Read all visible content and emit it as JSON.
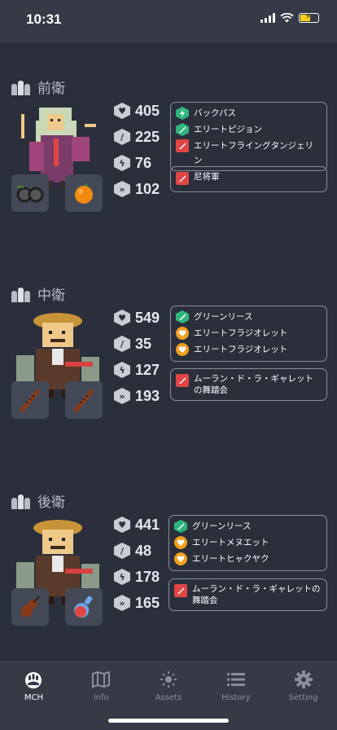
{
  "status_bar": {
    "time": "10:31"
  },
  "colors": {
    "background": "#2b2f3b",
    "skill_green": "#2fb67c",
    "skill_red": "#e04545",
    "skill_orange": "#f0a020"
  },
  "sections": [
    {
      "title": "前衛",
      "stats": {
        "hp": "405",
        "atk": "225",
        "int": "76",
        "agi": "102"
      },
      "skills": [
        {
          "icon": "green-lightning-skill-icon",
          "name": "バックパス"
        },
        {
          "icon": "green-sword-skill-icon",
          "name": "エリートピジョン"
        },
        {
          "icon": "red-sword-skill-icon",
          "name": "エリートフライングタンジェリン"
        }
      ],
      "extension": {
        "icon": "red-sword-skill-icon",
        "name": "尼将軍"
      },
      "equipment": [
        "goggles-icon",
        "orange-fruit-icon"
      ]
    },
    {
      "title": "中衛",
      "stats": {
        "hp": "549",
        "atk": "35",
        "int": "127",
        "agi": "193"
      },
      "skills": [
        {
          "icon": "green-sword-skill-icon",
          "name": "グリーンリース"
        },
        {
          "icon": "orange-heart-skill-icon",
          "name": "エリートフラジオレット"
        },
        {
          "icon": "orange-heart-skill-icon",
          "name": "エリートフラジオレット"
        }
      ],
      "extension": {
        "icon": "red-sword-skill-icon",
        "name": "ムーラン・ド・ラ・ギャレットの舞踏会"
      },
      "equipment": [
        "flute-icon",
        "flute-icon"
      ]
    },
    {
      "title": "後衛",
      "stats": {
        "hp": "441",
        "atk": "48",
        "int": "178",
        "agi": "165"
      },
      "skills": [
        {
          "icon": "green-sword-skill-icon",
          "name": "グリーンリース"
        },
        {
          "icon": "orange-heart-skill-icon",
          "name": "エリートメヌエット"
        },
        {
          "icon": "orange-heart-skill-icon",
          "name": "エリートヒャクヤク"
        }
      ],
      "extension": {
        "icon": "red-sword-skill-icon",
        "name": "ムーラン・ド・ラ・ギャレットの舞踏会"
      },
      "equipment": [
        "violin-icon",
        "potion-bottle-icon"
      ]
    }
  ],
  "tabs": [
    {
      "label": "MCH",
      "icon": "mch-paw-icon",
      "active": true
    },
    {
      "label": "Info",
      "icon": "map-icon",
      "active": false
    },
    {
      "label": "Assets",
      "icon": "sun-icon",
      "active": false
    },
    {
      "label": "History",
      "icon": "list-icon",
      "active": false
    },
    {
      "label": "Setting",
      "icon": "gear-icon",
      "active": false
    }
  ]
}
